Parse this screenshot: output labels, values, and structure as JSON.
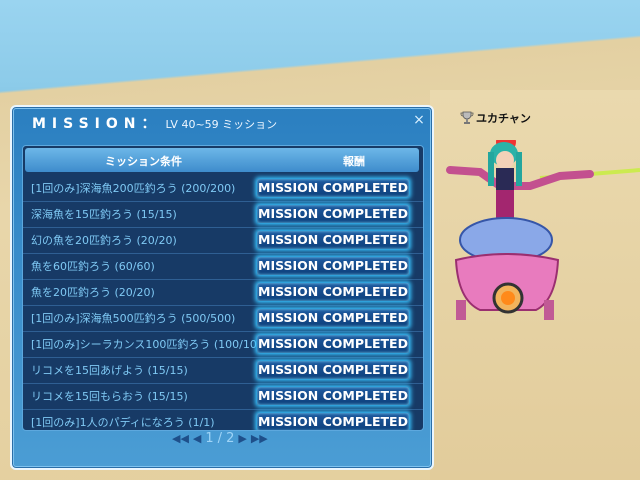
{
  "player": {
    "name": "ユカチャン"
  },
  "mission_window": {
    "title": "MISSION：",
    "subtitle": "LV 40~59 ミッション",
    "close_symbol": "×",
    "headers": {
      "condition": "ミッション条件",
      "reward": "報酬"
    },
    "missions": [
      {
        "condition": "[1回のみ]深海魚200匹釣ろう (200/200)",
        "status": "MISSION COMPLETED"
      },
      {
        "condition": "深海魚を15匹釣ろう (15/15)",
        "status": "MISSION COMPLETED"
      },
      {
        "condition": "幻の魚を20匹釣ろう (20/20)",
        "status": "MISSION COMPLETED"
      },
      {
        "condition": "魚を60匹釣ろう (60/60)",
        "status": "MISSION COMPLETED"
      },
      {
        "condition": "魚を20匹釣ろう (20/20)",
        "status": "MISSION COMPLETED"
      },
      {
        "condition": "[1回のみ]深海魚500匹釣ろう (500/500)",
        "status": "MISSION COMPLETED"
      },
      {
        "condition": "[1回のみ]シーラカンス100匹釣ろう (100/100)",
        "status": "MISSION COMPLETED"
      },
      {
        "condition": "リコメを15回あげよう (15/15)",
        "status": "MISSION COMPLETED"
      },
      {
        "condition": "リコメを15回もらおう (15/15)",
        "status": "MISSION COMPLETED"
      },
      {
        "condition": "[1回のみ]1人のパディになろう (1/1)",
        "status": "MISSION COMPLETED"
      }
    ],
    "pager": {
      "current": "1",
      "separator": "/",
      "total": "2"
    }
  }
}
